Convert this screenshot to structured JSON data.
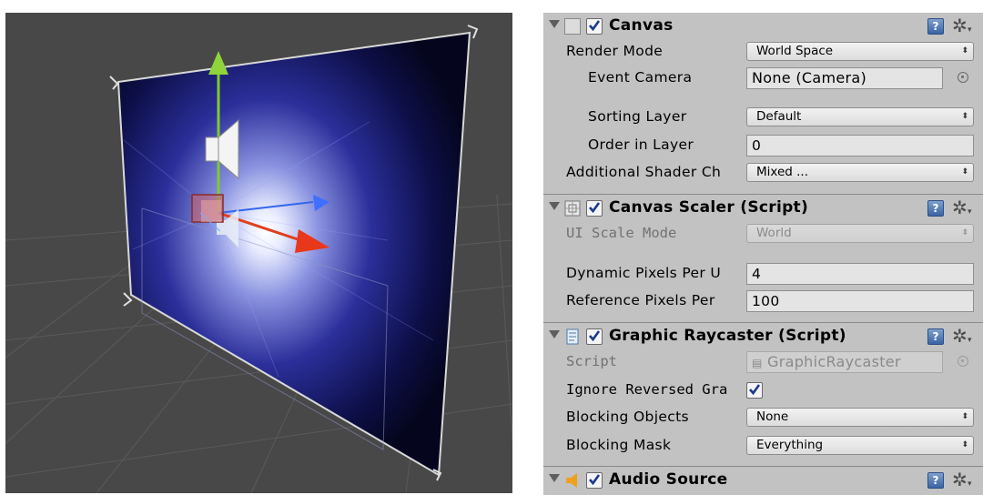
{
  "scene": {
    "background": "#484848",
    "gizmos": [
      "move-arrow-y",
      "move-arrow-x",
      "move-arrow-z",
      "audio-source-icon",
      "rect-handles"
    ]
  },
  "inspector": {
    "canvas": {
      "title": "Canvas",
      "enabled": true,
      "render_mode": {
        "label": "Render Mode",
        "value": "World Space"
      },
      "event_camera": {
        "label": "Event Camera",
        "value": "None (Camera)"
      },
      "sorting_layer": {
        "label": "Sorting Layer",
        "value": "Default"
      },
      "order_in_layer": {
        "label": "Order in Layer",
        "value": "0"
      },
      "additional_shader": {
        "label": "Additional Shader Ch",
        "value": "Mixed ..."
      }
    },
    "canvas_scaler": {
      "title": "Canvas Scaler (Script)",
      "enabled": true,
      "ui_scale_mode": {
        "label": "UI Scale Mode",
        "value": "World"
      },
      "dynamic_pixels": {
        "label": "Dynamic Pixels Per U",
        "value": "4"
      },
      "reference_pixels": {
        "label": "Reference Pixels Per",
        "value": "100"
      }
    },
    "graphic_raycaster": {
      "title": "Graphic Raycaster (Script)",
      "enabled": true,
      "script": {
        "label": "Script",
        "value": "GraphicRaycaster"
      },
      "ignore_reversed": {
        "label": "Ignore Reversed Gra",
        "checked": true
      },
      "blocking_objects": {
        "label": "Blocking Objects",
        "value": "None"
      },
      "blocking_mask": {
        "label": "Blocking Mask",
        "value": "Everything"
      }
    },
    "audio_source": {
      "title": "Audio Source",
      "enabled": true
    },
    "colors": {
      "panel_bg": "#c2c2c2",
      "help_icon": "#3b63a3",
      "audio_icon": "#f0a020"
    }
  }
}
